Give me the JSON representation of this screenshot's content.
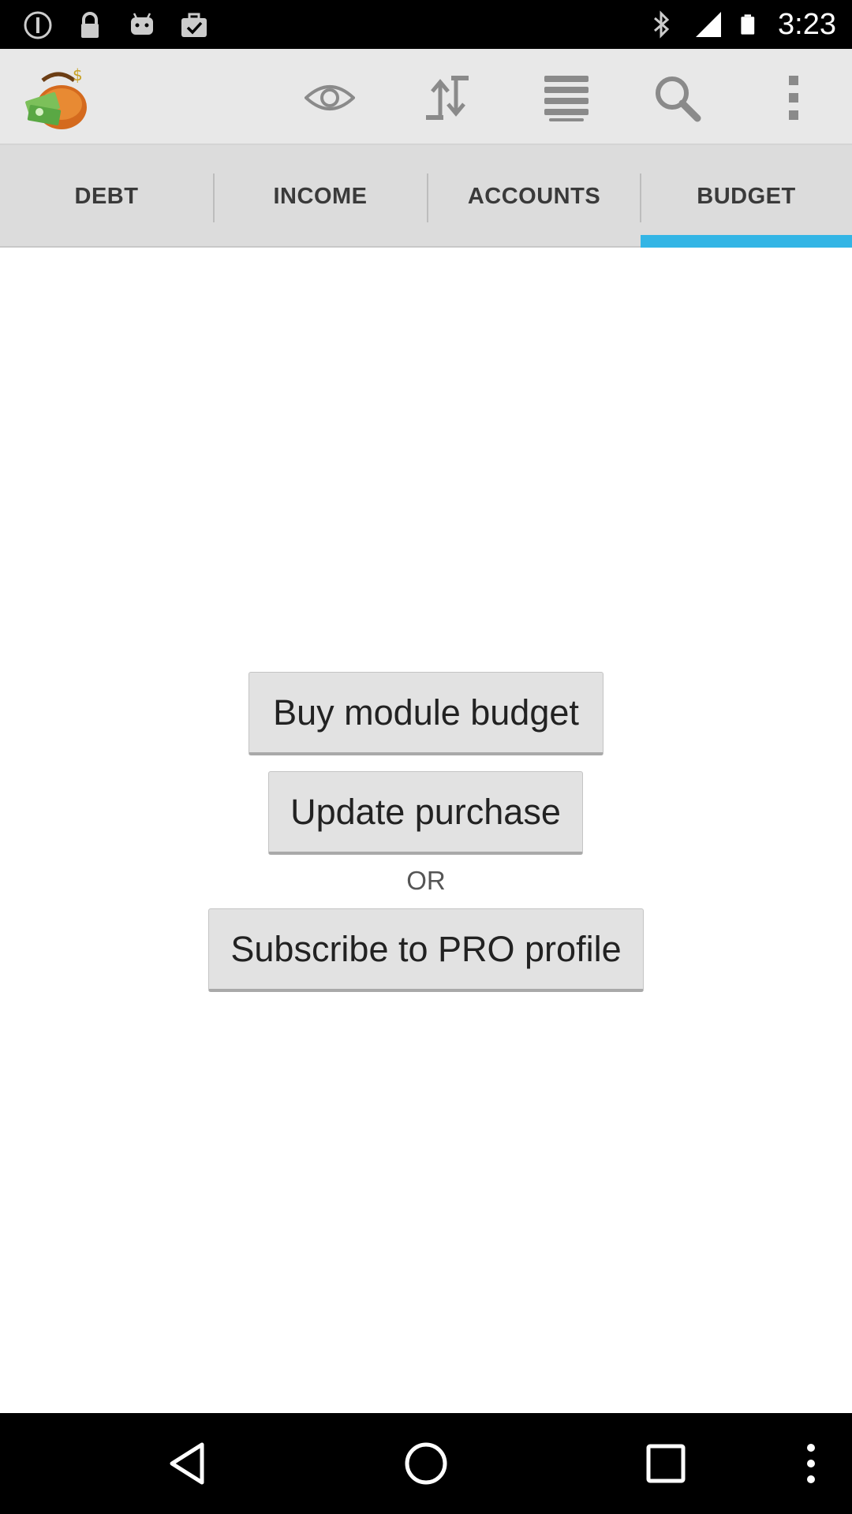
{
  "status_bar": {
    "time": "3:23",
    "icons": [
      "notification-icon",
      "lock-icon",
      "android-icon",
      "briefcase-check-icon",
      "bluetooth-icon",
      "signal-icon",
      "battery-icon"
    ]
  },
  "action_bar": {
    "icons": [
      "app-logo-wallet-icon",
      "eye-icon",
      "sort-icon",
      "list-icon",
      "search-icon",
      "overflow-menu-icon"
    ]
  },
  "tabs": [
    {
      "label": "DEBT",
      "selected": false
    },
    {
      "label": "INCOME",
      "selected": false
    },
    {
      "label": "ACCOUNTS",
      "selected": false
    },
    {
      "label": "BUDGET",
      "selected": true
    }
  ],
  "colors": {
    "tab_indicator": "#33b5e5",
    "action_bar_bg": "#e8e8e8",
    "tab_bar_bg": "#dcdcdc"
  },
  "main": {
    "buy_button_label": "Buy module budget",
    "update_button_label": "Update purchase",
    "or_text": "OR",
    "subscribe_button_label": "Subscribe to PRO profile"
  },
  "nav_bar": {
    "icons": [
      "back-icon",
      "home-icon",
      "recents-icon",
      "menu-icon"
    ]
  }
}
